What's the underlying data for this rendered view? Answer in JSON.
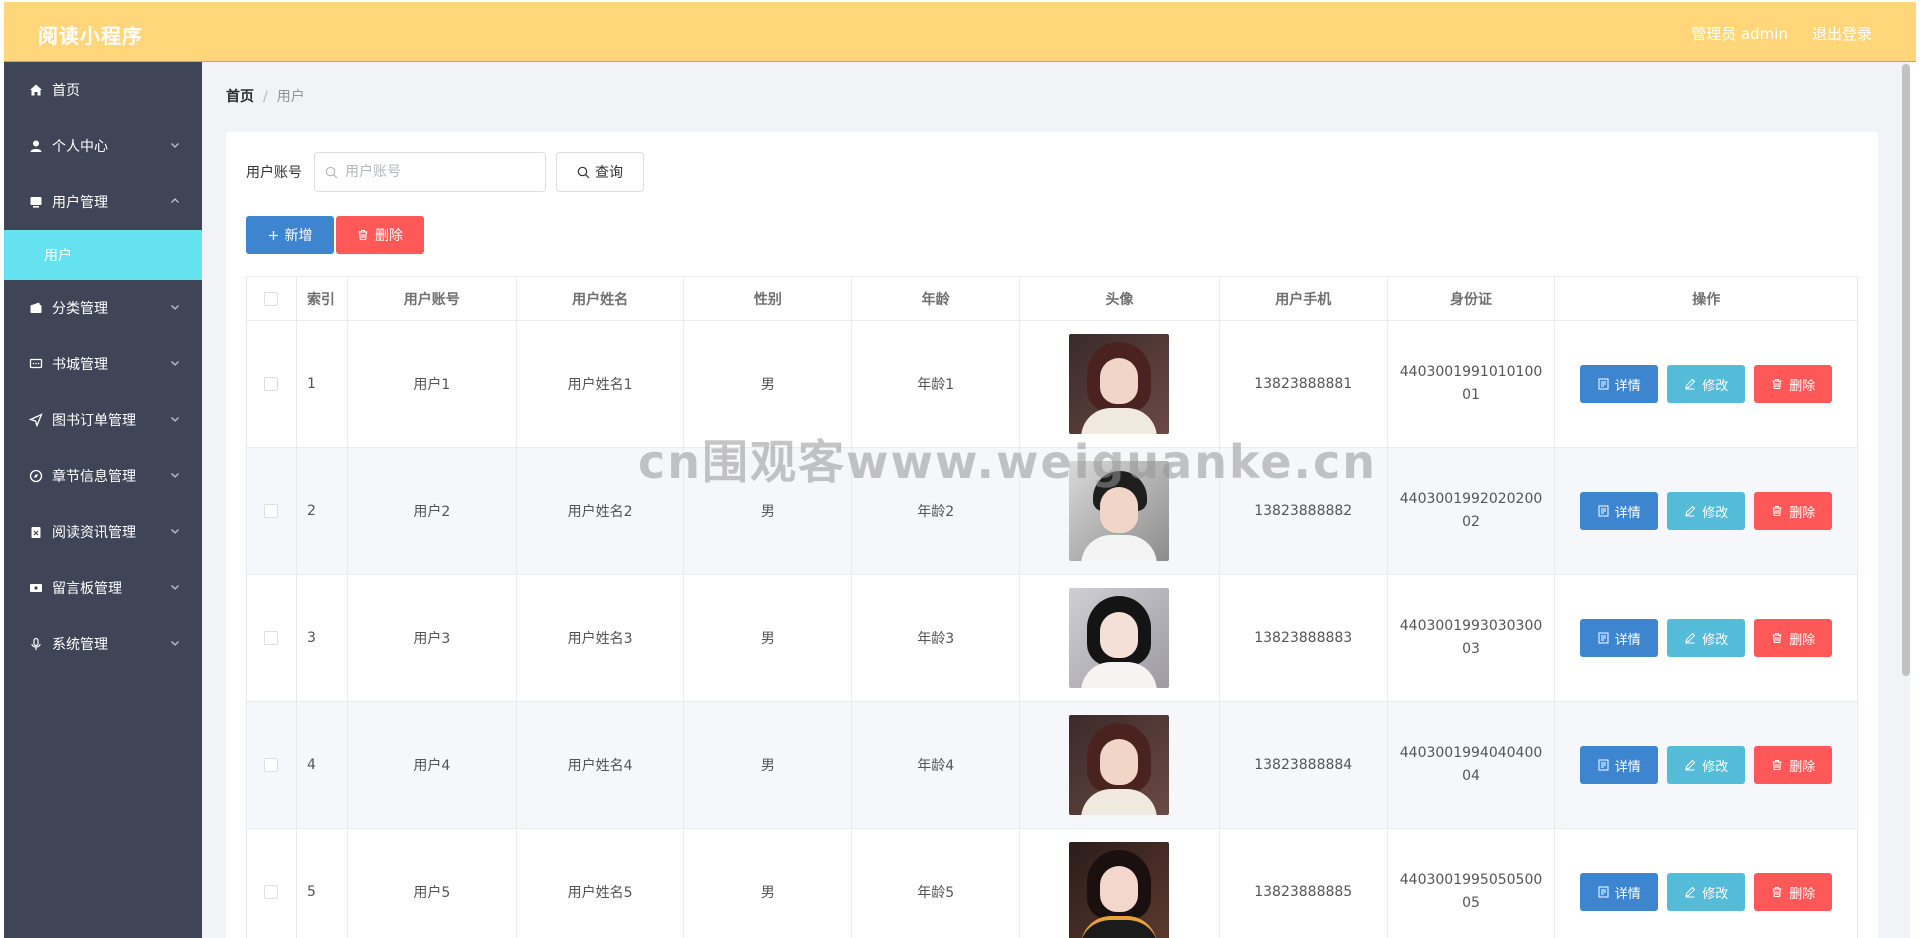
{
  "header": {
    "brand": "阅读小程序",
    "admin": "管理员 admin",
    "logout": "退出登录"
  },
  "sidebar": {
    "items": [
      {
        "label": "首页",
        "icon": "home-icon",
        "chevron": false
      },
      {
        "label": "个人中心",
        "icon": "user-icon",
        "chevron": true
      },
      {
        "label": "用户管理",
        "icon": "monitor-icon",
        "chevron": true,
        "expanded": true
      },
      {
        "label": "分类管理",
        "icon": "wallet-icon",
        "chevron": true
      },
      {
        "label": "书城管理",
        "icon": "chat-icon",
        "chevron": true
      },
      {
        "label": "图书订单管理",
        "icon": "send-icon",
        "chevron": true
      },
      {
        "label": "章节信息管理",
        "icon": "compass-icon",
        "chevron": true
      },
      {
        "label": "阅读资讯管理",
        "icon": "clipboard-icon",
        "chevron": true
      },
      {
        "label": "留言板管理",
        "icon": "ticket-icon",
        "chevron": true
      },
      {
        "label": "系统管理",
        "icon": "mic-icon",
        "chevron": true
      }
    ],
    "subitem": "用户"
  },
  "breadcrumb": {
    "home": "首页",
    "sep": "/",
    "current": "用户"
  },
  "search": {
    "label": "用户账号",
    "placeholder": "用户账号",
    "query_btn": "查询"
  },
  "actions": {
    "add": "新增",
    "delete": "删除"
  },
  "table": {
    "headers": [
      "索引",
      "用户账号",
      "用户姓名",
      "性别",
      "年龄",
      "头像",
      "用户手机",
      "身份证",
      "操作"
    ],
    "ops": {
      "detail": "详情",
      "edit": "修改",
      "delete": "删除"
    },
    "rows": [
      {
        "index": "1",
        "account": "用户1",
        "name": "用户姓名1",
        "sex": "男",
        "age": "年龄1",
        "phone": "13823888881",
        "idcard": "440300199101010001"
      },
      {
        "index": "2",
        "account": "用户2",
        "name": "用户姓名2",
        "sex": "男",
        "age": "年龄2",
        "phone": "13823888882",
        "idcard": "440300199202020002"
      },
      {
        "index": "3",
        "account": "用户3",
        "name": "用户姓名3",
        "sex": "男",
        "age": "年龄3",
        "phone": "13823888883",
        "idcard": "440300199303030003"
      },
      {
        "index": "4",
        "account": "用户4",
        "name": "用户姓名4",
        "sex": "男",
        "age": "年龄4",
        "phone": "13823888884",
        "idcard": "440300199404040004"
      },
      {
        "index": "5",
        "account": "用户5",
        "name": "用户姓名5",
        "sex": "男",
        "age": "年龄5",
        "phone": "13823888885",
        "idcard": "440300199505050005"
      }
    ]
  },
  "watermark": "cn围观客www.weiguanke.cn",
  "colors": {
    "header": "#ffd67a",
    "sidebar": "#3f4556",
    "active_sub": "#64e2f0",
    "primary": "#3d86cf",
    "info": "#54bbd9",
    "danger": "#ff5858"
  }
}
